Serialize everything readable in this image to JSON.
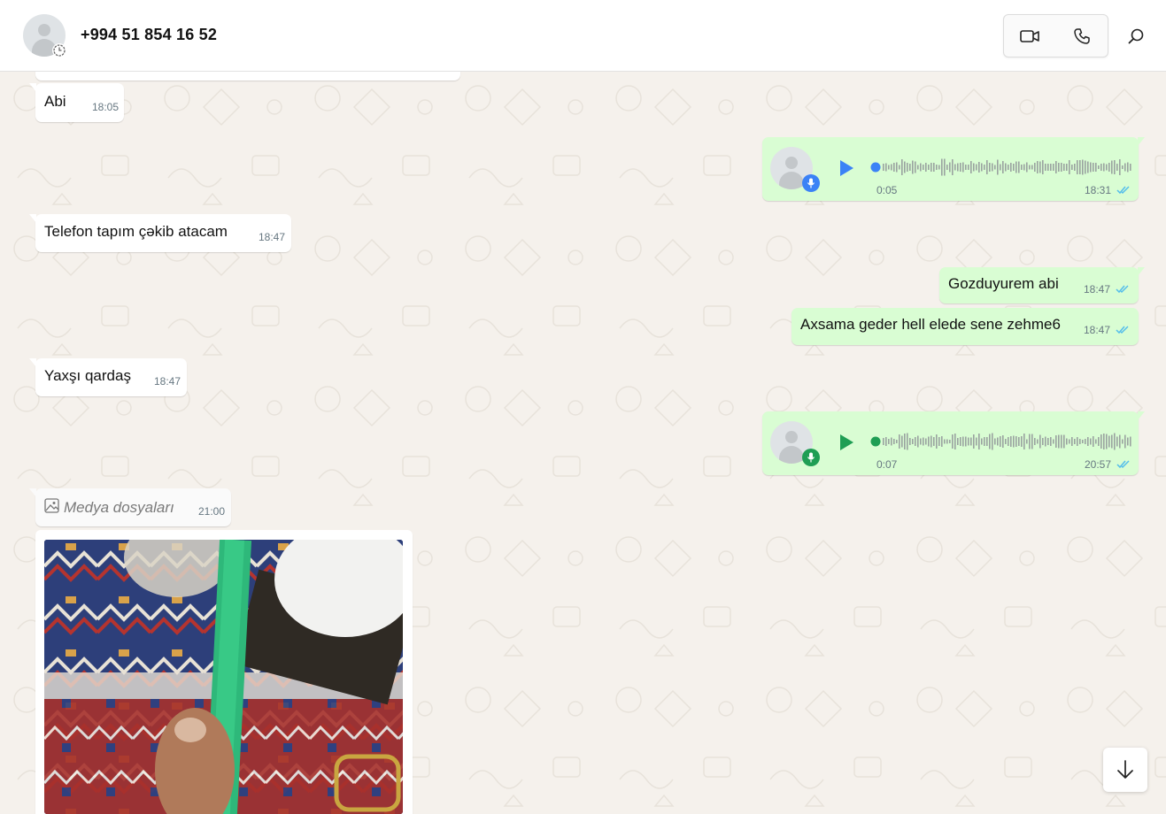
{
  "header": {
    "contact_name": "+994 51 854 16 52",
    "avatar_icon": "default-avatar-icon",
    "status_icon": "timer-icon",
    "video_call_icon": "video-camera-icon",
    "voice_call_icon": "phone-icon",
    "search_icon": "search-icon"
  },
  "messages": [
    {
      "direction": "in",
      "type": "text",
      "text": "Abi",
      "time": "18:05"
    },
    {
      "direction": "out",
      "type": "voice",
      "duration": "0:05",
      "time": "18:31",
      "status": "read",
      "played": false
    },
    {
      "direction": "in",
      "type": "text",
      "text": "Telefon tapım çəkib atacam",
      "time": "18:47"
    },
    {
      "direction": "out",
      "type": "text",
      "text": "Gozduyurem abi",
      "time": "18:47",
      "status": "read"
    },
    {
      "direction": "out",
      "type": "text",
      "text": "Axsama geder hell elede sene zehme6",
      "time": "18:47",
      "status": "read"
    },
    {
      "direction": "in",
      "type": "text",
      "text": "Yaxşı qardaş",
      "time": "18:47"
    },
    {
      "direction": "out",
      "type": "voice",
      "duration": "0:07",
      "time": "20:57",
      "status": "read",
      "played": true
    },
    {
      "direction": "in",
      "type": "media-label",
      "text": "Medya dosyaları",
      "time": "21:00",
      "icon": "image-icon"
    },
    {
      "direction": "in",
      "type": "photo"
    }
  ],
  "colors": {
    "incoming_bubble": "#ffffff",
    "outgoing_bubble": "#d9fdd3",
    "read_ticks": "#53bdeb",
    "play_unplayed": "#3b82f6",
    "play_played": "#1f9e54"
  },
  "scroll_button_icon": "arrow-down-icon"
}
